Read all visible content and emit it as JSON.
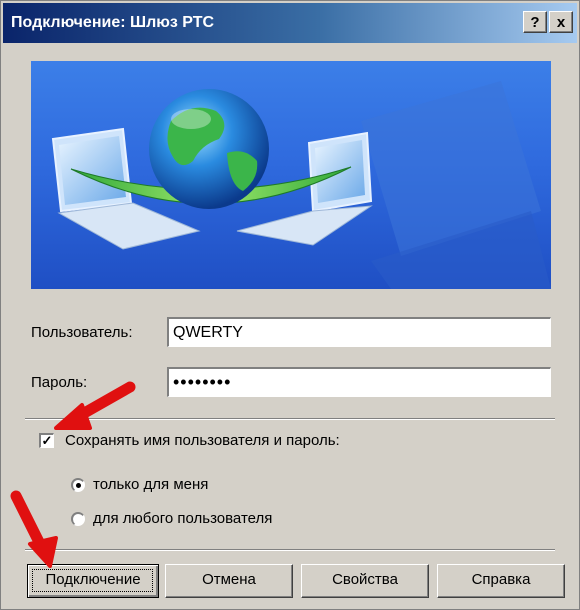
{
  "window": {
    "title": "Подключение: Шлюз РТС",
    "help_label": "?",
    "close_label": "x"
  },
  "form": {
    "user_label": "Пользователь:",
    "user_value": "QWERTY",
    "password_label": "Пароль:",
    "password_value": "••••••••",
    "save_checkbox_label": "Сохранять имя пользователя и пароль:",
    "save_checked": true,
    "radio_only_me": "только для меня",
    "radio_any_user": "для любого пользователя",
    "selected_option": "только для меня"
  },
  "buttons": {
    "connect": "Подключение",
    "cancel": "Отмена",
    "properties": "Свойства",
    "help": "Справка"
  },
  "icons": {
    "banner": "network-connection-globe-laptops-illustration",
    "annotation": "red-arrow-icon"
  },
  "colors": {
    "titlebar_start": "#0a246a",
    "dialog_bg": "#d4d0c8",
    "banner_blue": "#2f6ade",
    "arrow_red": "#e01010"
  }
}
